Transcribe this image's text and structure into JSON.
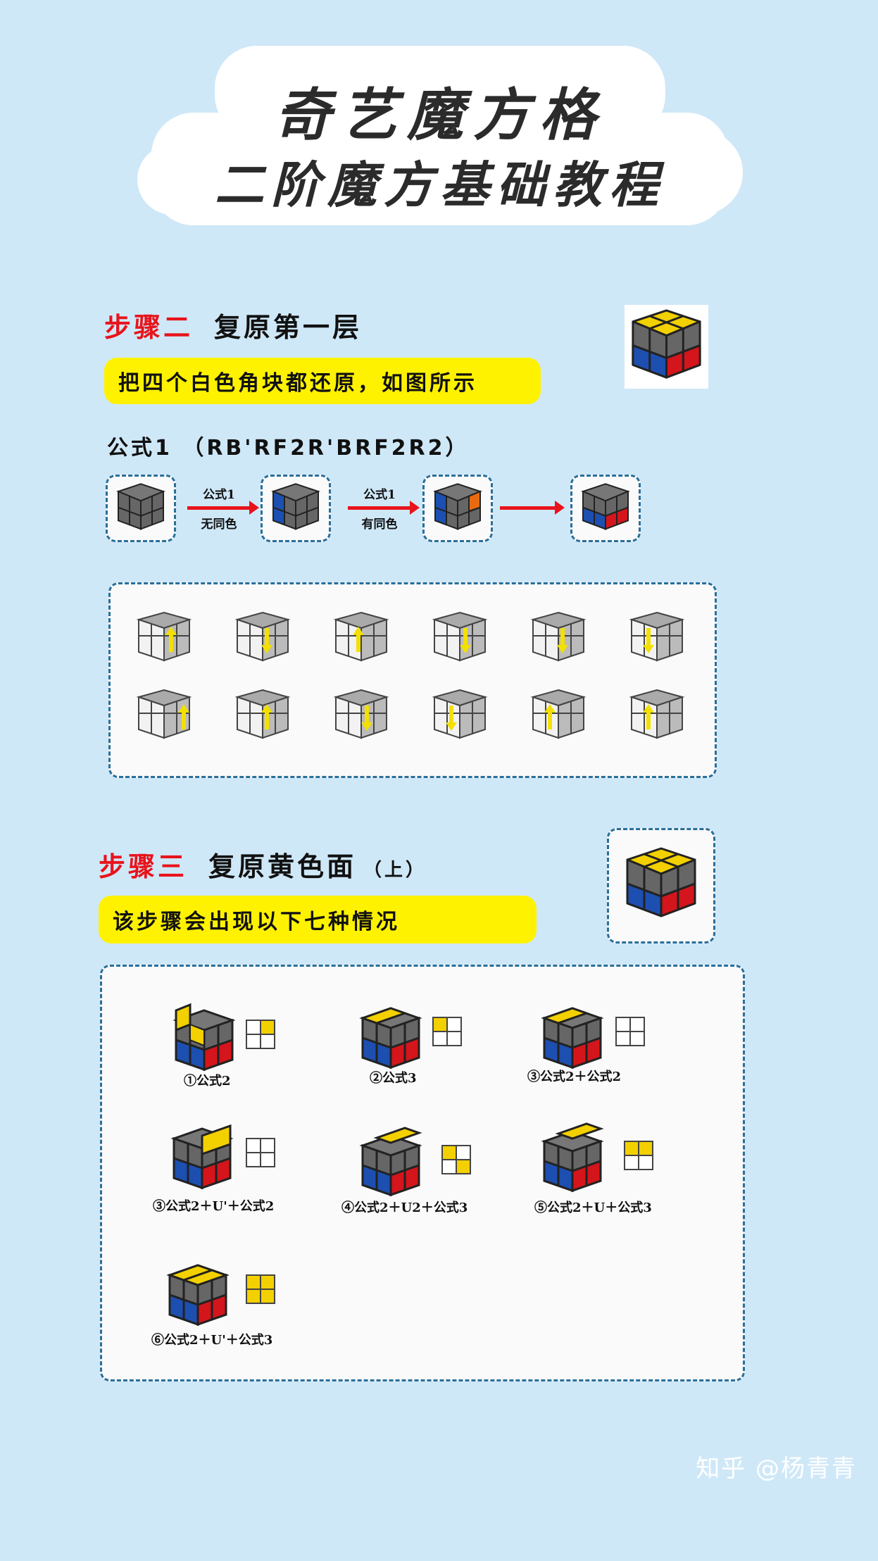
{
  "title": {
    "line1": "奇艺魔方格",
    "line2": "二阶魔方基础教程"
  },
  "step2": {
    "num": "步骤二",
    "text": "复原第一层",
    "banner": "把四个白色角块都还原，如图所示",
    "formula": "公式1 （RB'RF2R'BRF2R2）",
    "arrows": [
      {
        "top": "公式1",
        "bottom": "无同色"
      },
      {
        "top": "公式1",
        "bottom": "有同色"
      }
    ]
  },
  "step3": {
    "num": "步骤三",
    "text": "复原黄色面",
    "sub": "（上）",
    "banner": "该步骤会出现以下七种情况",
    "cases": [
      "①公式2",
      "②公式3",
      "③公式2＋公式2",
      "③公式2＋U'＋公式2",
      "④公式2＋U2＋公式3",
      "⑤公式2＋U＋公式3",
      "⑥公式2＋U'＋公式3"
    ]
  },
  "colors": {
    "background": "#cfe8f8",
    "accent_red": "#e8141b",
    "banner_yellow": "#fff200",
    "border_blue": "#2a6f9a"
  },
  "watermark": "知乎 @杨青青"
}
